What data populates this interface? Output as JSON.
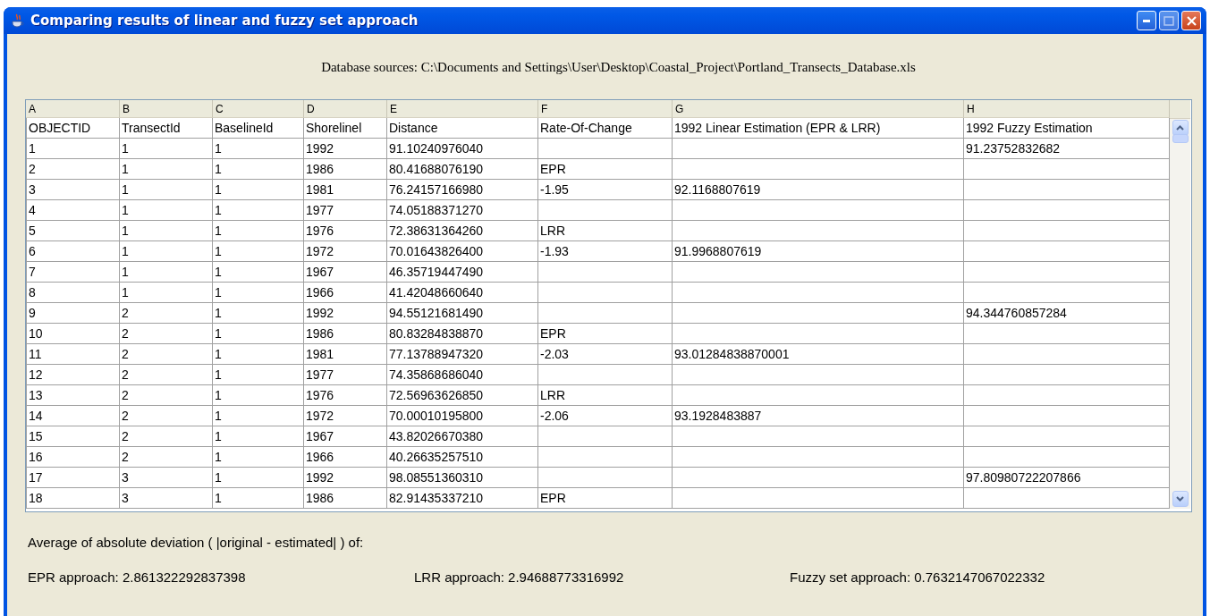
{
  "window": {
    "title": "Comparing results of linear and fuzzy set approach"
  },
  "source_line": "Database sources: C:\\Documents and Settings\\User\\Desktop\\Coastal_Project\\Portland_Transects_Database.xls",
  "table": {
    "columns": [
      "A",
      "B",
      "C",
      "D",
      "E",
      "F",
      "G",
      "H"
    ],
    "rows": [
      [
        "OBJECTID",
        "TransectId",
        "BaselineId",
        "Shorelinel",
        "Distance",
        "Rate-Of-Change",
        "1992 Linear Estimation (EPR & LRR)",
        "1992 Fuzzy Estimation"
      ],
      [
        "1",
        "1",
        "1",
        "1992",
        "91.10240976040",
        "",
        "",
        "91.23752832682"
      ],
      [
        "2",
        "1",
        "1",
        "1986",
        "80.41688076190",
        "EPR",
        "",
        ""
      ],
      [
        "3",
        "1",
        "1",
        "1981",
        "76.24157166980",
        "-1.95",
        "92.1168807619",
        ""
      ],
      [
        "4",
        "1",
        "1",
        "1977",
        "74.05188371270",
        "",
        "",
        ""
      ],
      [
        "5",
        "1",
        "1",
        "1976",
        "72.38631364260",
        "LRR",
        "",
        ""
      ],
      [
        "6",
        "1",
        "1",
        "1972",
        "70.01643826400",
        "-1.93",
        "91.9968807619",
        ""
      ],
      [
        "7",
        "1",
        "1",
        "1967",
        "46.35719447490",
        "",
        "",
        ""
      ],
      [
        "8",
        "1",
        "1",
        "1966",
        "41.42048660640",
        "",
        "",
        ""
      ],
      [
        "9",
        "2",
        "1",
        "1992",
        "94.55121681490",
        "",
        "",
        "94.344760857284"
      ],
      [
        "10",
        "2",
        "1",
        "1986",
        "80.83284838870",
        "EPR",
        "",
        ""
      ],
      [
        "11",
        "2",
        "1",
        "1981",
        "77.13788947320",
        "-2.03",
        "93.01284838870001",
        ""
      ],
      [
        "12",
        "2",
        "1",
        "1977",
        "74.35868686040",
        "",
        "",
        ""
      ],
      [
        "13",
        "2",
        "1",
        "1976",
        "72.56963626850",
        "LRR",
        "",
        ""
      ],
      [
        "14",
        "2",
        "1",
        "1972",
        "70.00010195800",
        "-2.06",
        "93.1928483887",
        ""
      ],
      [
        "15",
        "2",
        "1",
        "1967",
        "43.82026670380",
        "",
        "",
        ""
      ],
      [
        "16",
        "2",
        "1",
        "1966",
        "40.26635257510",
        "",
        "",
        ""
      ],
      [
        "17",
        "3",
        "1",
        "1992",
        "98.08551360310",
        "",
        "",
        "97.80980722207866"
      ],
      [
        "18",
        "3",
        "1",
        "1986",
        "82.91435337210",
        "EPR",
        "",
        ""
      ]
    ]
  },
  "summary": {
    "heading": "Average of absolute deviation ( |original - estimated| ) of:",
    "results": [
      "EPR approach: 2.861322292837398",
      "LRR approach: 2.94688773316992",
      "Fuzzy set approach: 0.7632147067022332"
    ]
  }
}
